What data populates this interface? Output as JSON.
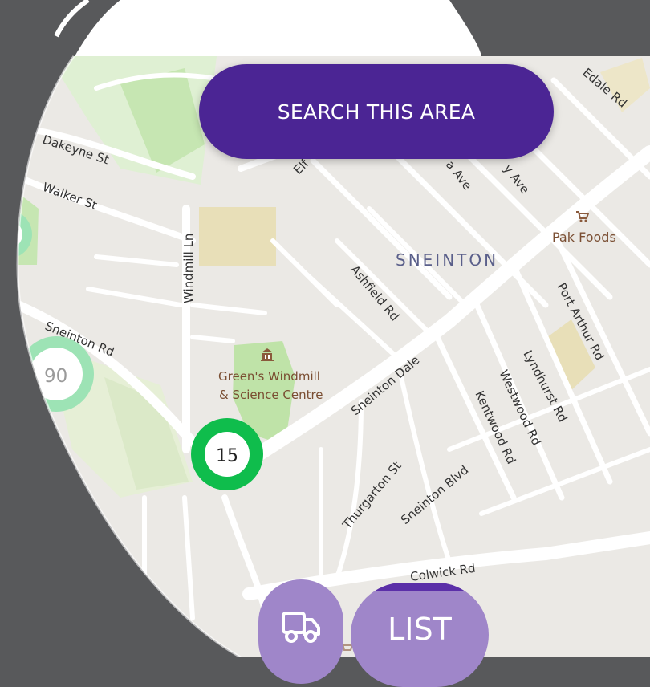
{
  "search_button_label": "SEARCH THIS AREA",
  "list_button_label": "LIST",
  "area_label": "SNEINTON",
  "poi": {
    "shop": "Pak Foods",
    "attraction_line1": "Green's Windmill",
    "attraction_line2": "& Science Centre"
  },
  "streets": {
    "dakeyne": "Dakeyne St",
    "walker": "Walker St",
    "sneinton_rd": "Sneinton Rd",
    "windmill_ln": "Windmill Ln",
    "elf": "Elf",
    "ashfield": "Ashfield Rd",
    "sneinton_dale": "Sneinton Dale",
    "port_arthur": "Port Arthur Rd",
    "lyndhurst": "Lyndhurst Rd",
    "westwood": "Westwood Rd",
    "kentwood": "Kentwood Rd",
    "sneinton_blvd": "Sneinton Blvd",
    "thurgarton": "Thurgarton St",
    "colwick": "Colwick Rd",
    "edale": "Edale Rd",
    "ave1": "a Ave",
    "ave2": "y Ave"
  },
  "markers": {
    "main": "15",
    "left": "90"
  },
  "colors": {
    "background": "#58595b",
    "map_land": "#ebe9e5",
    "park": "#c6e6b2",
    "brand_purple": "#4b2594",
    "marker_green": "#0fbd4c",
    "marker_light_green": "#9de3b5"
  },
  "icons": {
    "truck": "delivery-truck-icon",
    "shop": "shopping-cart-icon",
    "museum": "museum-icon"
  }
}
